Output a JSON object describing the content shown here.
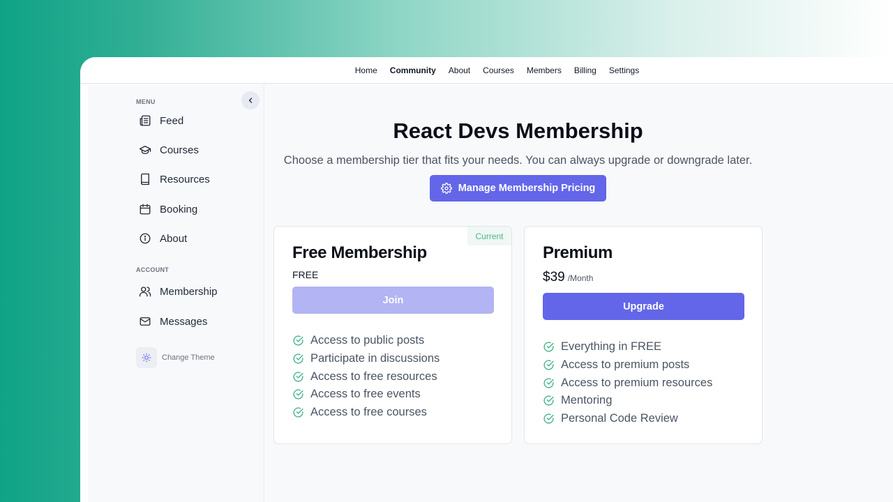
{
  "topnav": {
    "items": [
      {
        "label": "Home",
        "active": false
      },
      {
        "label": "Community",
        "active": true
      },
      {
        "label": "About",
        "active": false
      },
      {
        "label": "Courses",
        "active": false
      },
      {
        "label": "Members",
        "active": false
      },
      {
        "label": "Billing",
        "active": false
      },
      {
        "label": "Settings",
        "active": false
      }
    ]
  },
  "sidebar": {
    "menu_label": "MENU",
    "menu_items": [
      {
        "label": "Feed",
        "icon": "newspaper-icon"
      },
      {
        "label": "Courses",
        "icon": "graduation-cap-icon"
      },
      {
        "label": "Resources",
        "icon": "book-icon"
      },
      {
        "label": "Booking",
        "icon": "calendar-icon"
      },
      {
        "label": "About",
        "icon": "info-icon"
      }
    ],
    "account_label": "ACCOUNT",
    "account_items": [
      {
        "label": "Membership",
        "icon": "users-icon"
      },
      {
        "label": "Messages",
        "icon": "mail-icon"
      }
    ],
    "theme_label": "Change Theme"
  },
  "main": {
    "title": "React Devs Membership",
    "subtitle": "Choose a membership tier that fits your needs. You can always upgrade or downgrade later.",
    "manage_label": "Manage Membership Pricing"
  },
  "plans": {
    "free": {
      "badge": "Current",
      "title": "Free Membership",
      "price": "FREE",
      "cta": "Join",
      "features": [
        "Access to public posts",
        "Participate in discussions",
        "Access to free resources",
        "Access to free events",
        "Access to free courses"
      ]
    },
    "premium": {
      "title": "Premium",
      "price": "$39",
      "period": "/Month",
      "cta": "Upgrade",
      "features": [
        "Everything in FREE",
        "Access to premium posts",
        "Access to premium resources",
        "Mentoring",
        "Personal Code Review"
      ]
    }
  },
  "colors": {
    "accent": "#6366e8",
    "accent_disabled": "#b2b4f3",
    "success": "#4bb488"
  }
}
